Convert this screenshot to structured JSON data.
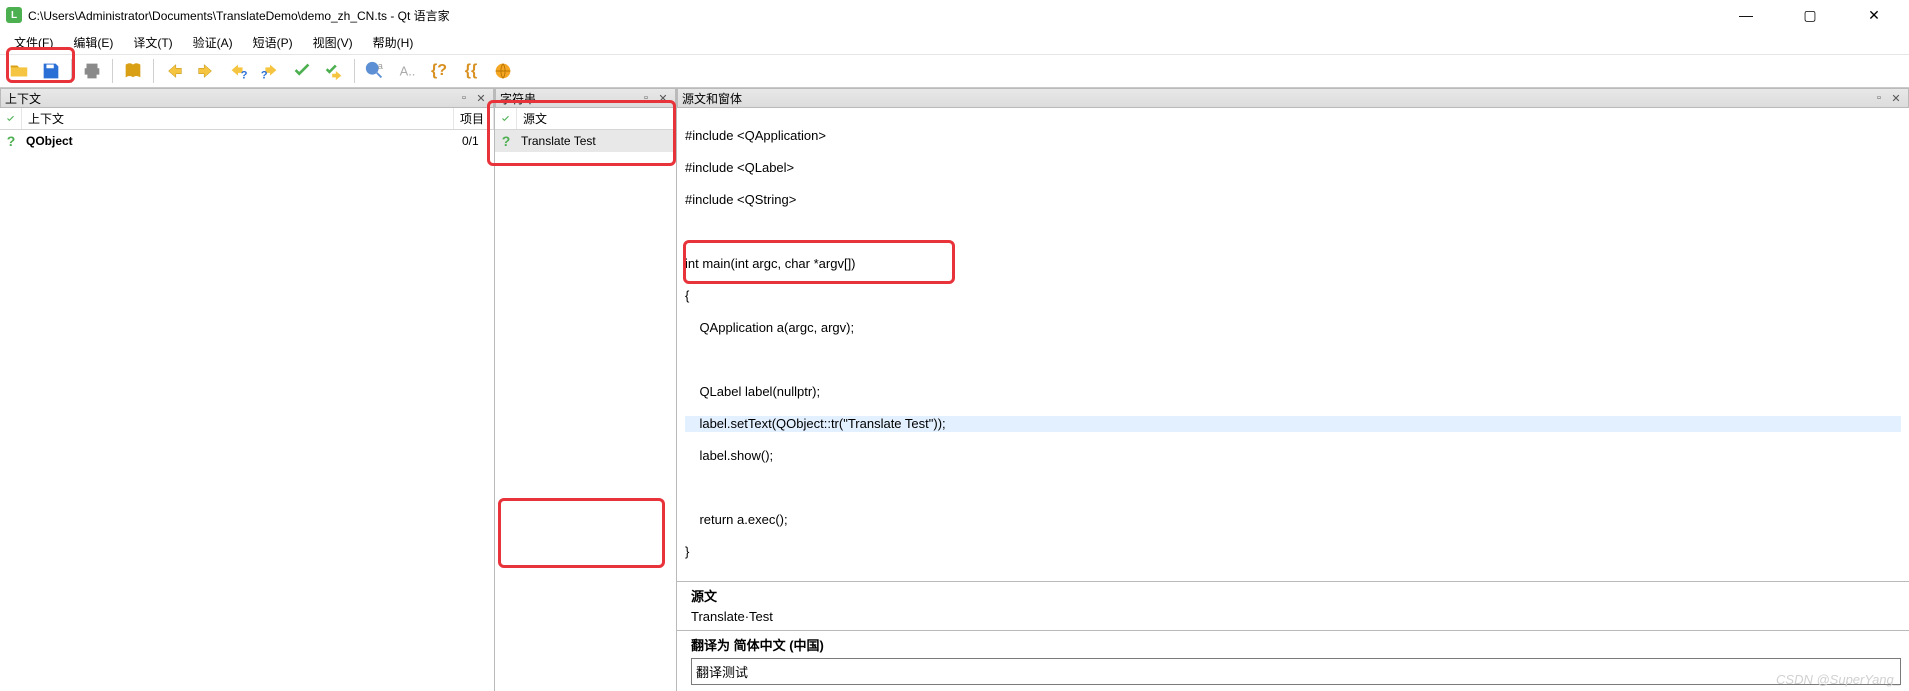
{
  "window": {
    "title": "C:\\Users\\Administrator\\Documents\\TranslateDemo\\demo_zh_CN.ts - Qt 语言家",
    "min": "—",
    "max": "▢",
    "close": "✕"
  },
  "menu": {
    "file": "文件(F)",
    "edit": "编辑(E)",
    "translate": "译文(T)",
    "validate": "验证(A)",
    "phrases": "短语(P)",
    "view": "视图(V)",
    "help": "帮助(H)"
  },
  "toolbar": {
    "open": "open",
    "save": "save",
    "print": "print",
    "phrasebook": "phrasebook",
    "prev": "prev",
    "next": "next",
    "prev_unfinished": "prev-unfinished",
    "next_unfinished": "next-unfinished",
    "done": "done",
    "done_next": "done-next",
    "find_phrase": "find-phrase",
    "gray1": "gray1",
    "brace_q": "brace-q",
    "braces": "braces",
    "globe": "globe"
  },
  "panels": {
    "context": {
      "title": "上下文",
      "col_status": "",
      "col_name": "上下文",
      "col_items": "项目",
      "row_name": "QObject",
      "row_items": "0/1"
    },
    "strings": {
      "title": "字符串",
      "col_status": "",
      "col_text": "源文",
      "row_text": "Translate Test"
    },
    "source": {
      "title": "源文和窗体"
    }
  },
  "code": {
    "l1": "#include <QApplication>",
    "l2": "#include <QLabel>",
    "l3": "#include <QString>",
    "l4": "",
    "l5": "int main(int argc, char *argv[])",
    "l6": "{",
    "l7": "    QApplication a(argc, argv);",
    "l8": "",
    "l9": "    QLabel label(nullptr);",
    "l10": "    label.setText(QObject::tr(\"Translate Test\"));",
    "l11": "    label.show();",
    "l12": "",
    "l13": "    return a.exec();",
    "l14": "}"
  },
  "translation": {
    "source_hdr": "源文",
    "source_text": "Translate·Test",
    "target_hdr": "翻译为 简体中文 (中国)",
    "target_text": "翻译测试"
  },
  "watermark": "CSDN @SuperYang_"
}
